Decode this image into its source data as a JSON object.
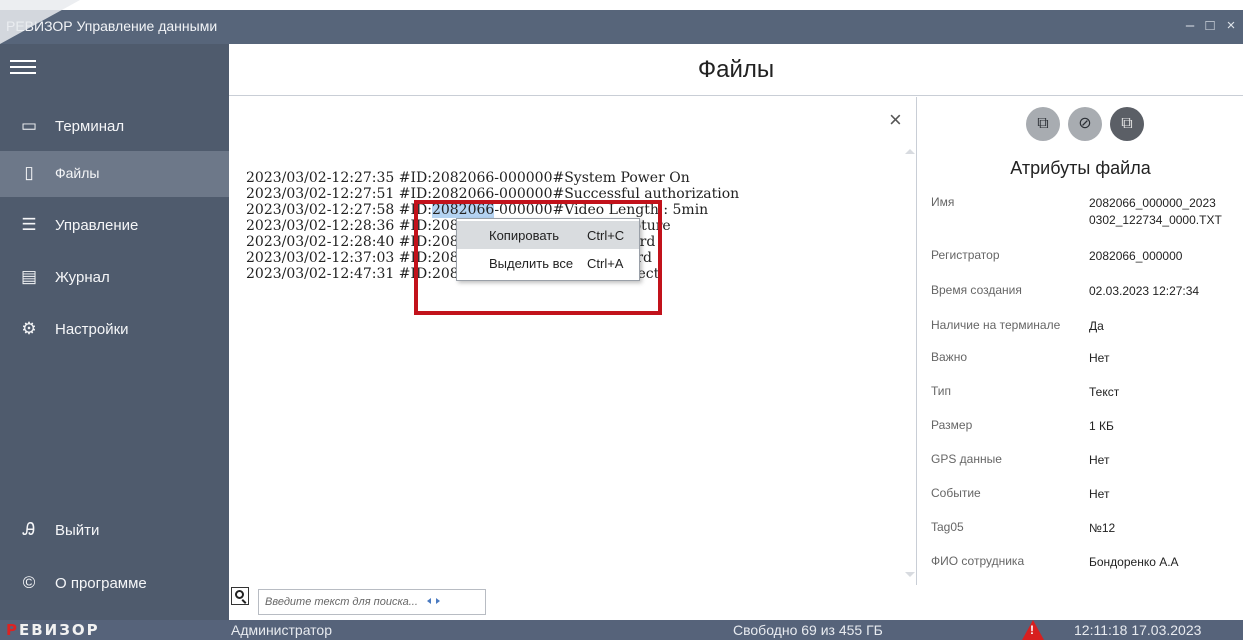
{
  "window": {
    "title": "РЕВИЗОР Управление данными",
    "minimize_glyph": "–",
    "maximize_glyph": "□",
    "close_glyph": "×"
  },
  "sidebar": {
    "menu_icon": "hamburger-icon",
    "items": [
      {
        "label": "Терминал",
        "icon": "terminal-icon",
        "glyph": "▭"
      },
      {
        "label": "Файлы",
        "icon": "file-icon",
        "glyph": "▯"
      },
      {
        "label": "Управление",
        "icon": "sliders-icon",
        "glyph": "☰"
      },
      {
        "label": "Журнал",
        "icon": "journal-icon",
        "glyph": "▤"
      },
      {
        "label": "Настройки",
        "icon": "gear-icon",
        "glyph": "⚙"
      }
    ],
    "bottom_items": [
      {
        "label": "Выйти",
        "icon": "user-exit-icon",
        "glyph": "Ꭿ"
      },
      {
        "label": "О программе",
        "icon": "copyright-icon",
        "glyph": "©"
      }
    ],
    "active_index": 1
  },
  "header": {
    "title": "Файлы"
  },
  "content": {
    "close_glyph": "×",
    "log_lines": [
      {
        "pre": "2023/03/02-12:27:35 #ID:2082066-000000#System Power On",
        "hl": "",
        "post": ""
      },
      {
        "pre": "2023/03/02-12:27:51 #ID:2082066-000000#Successful authorization",
        "hl": "",
        "post": ""
      },
      {
        "pre": "2023/03/02-12:27:58 #ID:",
        "hl": "2082066",
        "post": "-000000#Video Length : 5min"
      },
      {
        "pre": "2023/03/02-12:28:36 #ID:2082066-000000#Image Capture",
        "hl": "",
        "post": ""
      },
      {
        "pre": "2023/03/02-12:28:40 #ID:2082066-000000#Start Record",
        "hl": "",
        "post": ""
      },
      {
        "pre": "2023/03/02-12:37:03 #ID:2082066-000000#Stop Record",
        "hl": "",
        "post": ""
      },
      {
        "pre": "2023/03/02-12:47:31 #ID:2082066-000000#USB Connect",
        "hl": "",
        "post": ""
      }
    ]
  },
  "context_menu": {
    "items": [
      {
        "label": "Копировать",
        "shortcut": "Ctrl+C"
      },
      {
        "label": "Выделить все",
        "shortcut": "Ctrl+A"
      }
    ],
    "hover_index": 0,
    "highlight_color": "#c2121b"
  },
  "search": {
    "placeholder": "Введите текст для поиска...",
    "value": ""
  },
  "attributes": {
    "title": "Атрибуты файла",
    "toolbar": [
      {
        "icon": "copy-icon",
        "glyph": "⧉"
      },
      {
        "icon": "eraser-icon",
        "glyph": "⊘"
      },
      {
        "icon": "monitor-transfer-icon",
        "glyph": "⧉"
      }
    ],
    "rows": [
      {
        "key": "Имя",
        "value": "2082066_000000_2023\n0302_122734_0000.TXT"
      },
      {
        "key": "Регистратор",
        "value": "2082066_000000"
      },
      {
        "key": "Время создания",
        "value": "02.03.2023 12:27:34"
      },
      {
        "key": "Наличие на терминале",
        "value": "Да"
      },
      {
        "key": "Важно",
        "value": "Нет"
      },
      {
        "key": "Тип",
        "value": "Текст"
      },
      {
        "key": "Размер",
        "value": "1 КБ"
      },
      {
        "key": "GPS данные",
        "value": "Нет"
      },
      {
        "key": "Событие",
        "value": "Нет"
      },
      {
        "key": "Tag05",
        "value": "№12"
      },
      {
        "key": "ФИО сотрудника",
        "value": "Бондоренко А.А"
      }
    ]
  },
  "statusbar": {
    "brand_first": "Р",
    "brand_rest": "ЕВИЗОР",
    "user": "Администратор",
    "free_space": "Свободно 69 из 455 ГБ",
    "warning_icon": "warning-icon",
    "warning_mark": "!",
    "clock": "12:11:18 17.03.2023"
  },
  "colors": {
    "sidebar": "#4f5b6d",
    "sidebar_active": "#6d7889",
    "titlebar": "#57657a",
    "statusbar": "#56637a",
    "selection": "#b4d3f2",
    "brand_red": "#d22"
  }
}
